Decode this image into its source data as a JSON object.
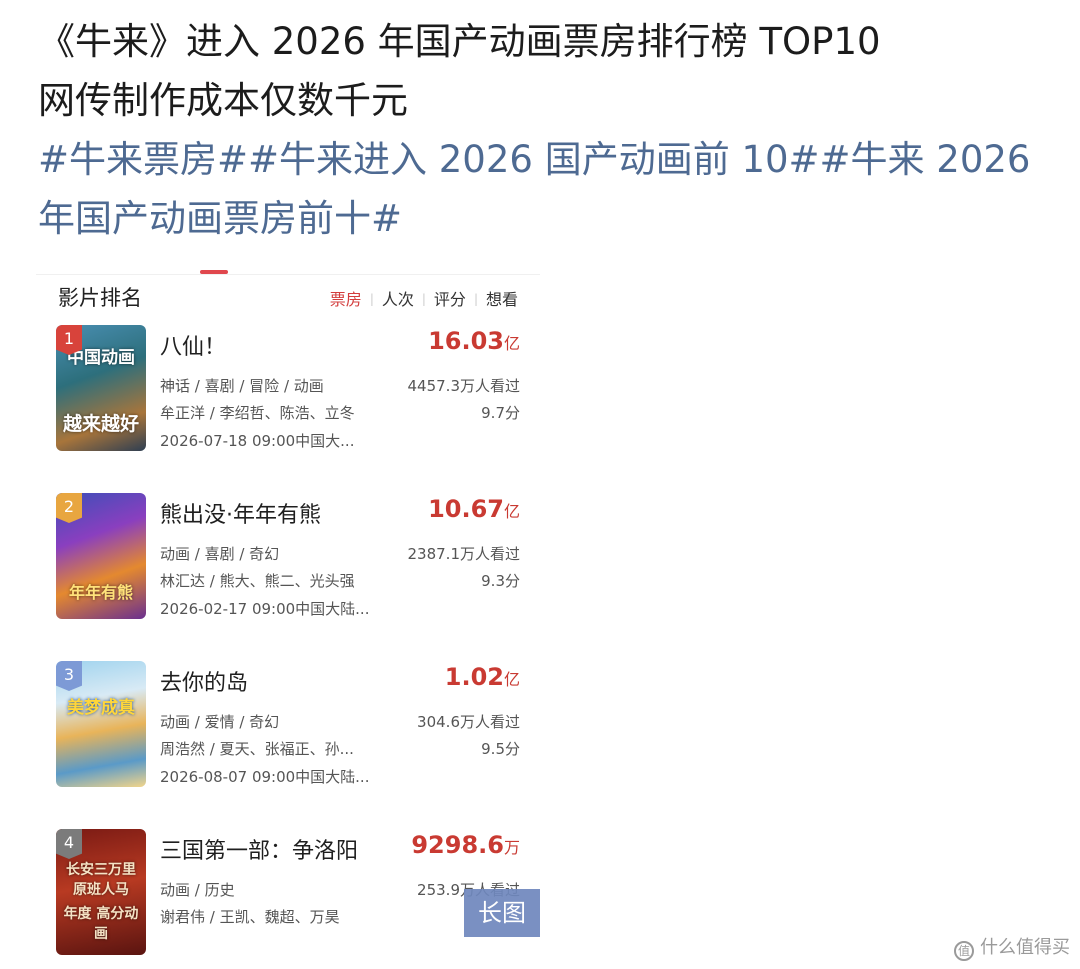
{
  "post": {
    "line1": "《牛来》进入 2026 年国产动画票房排行榜 TOP10",
    "line2": "网传制作成本仅数千元",
    "tags_line1": "#牛来票房##牛来进入 2026 国产动画前 10##牛来 2026",
    "tags_line2": "年国产动画票房前十#"
  },
  "ranking": {
    "title": "影片排名",
    "tabs": [
      "票房",
      "人次",
      "评分",
      "想看"
    ],
    "active_tab": "票房",
    "movies": [
      {
        "rank": "1",
        "name": "八仙！",
        "box_office": "16.03",
        "unit": "亿",
        "genres": "神话 / 喜剧 / 冒险 / 动画",
        "viewers": "4457.3万人看过",
        "cast": "牟正洋 / 李绍哲、陈浩、立冬",
        "score": "9.7分",
        "release": "2026-07-18 09:00中国大...",
        "poster_top": "中国动画",
        "poster_bottom": "越来越好"
      },
      {
        "rank": "2",
        "name": "熊出没·年年有熊",
        "box_office": "10.67",
        "unit": "亿",
        "genres": "动画 / 喜剧 / 奇幻",
        "viewers": "2387.1万人看过",
        "cast": "林汇达 / 熊大、熊二、光头强",
        "score": "9.3分",
        "release": "2026-02-17 09:00中国大陆...",
        "poster_top": "",
        "poster_bottom": "年年有熊"
      },
      {
        "rank": "3",
        "name": "去你的岛",
        "box_office": "1.02",
        "unit": "亿",
        "genres": "动画 / 爱情 / 奇幻",
        "viewers": "304.6万人看过",
        "cast": "周浩然 / 夏天、张福正、孙...",
        "score": "9.5分",
        "release": "2026-08-07 09:00中国大陆...",
        "poster_top": "美梦成真",
        "poster_bottom": ""
      },
      {
        "rank": "4",
        "name": "三国第一部：争洛阳",
        "box_office": "9298.6",
        "unit": "万",
        "genres": "动画 / 历史",
        "viewers": "253.9万人看过",
        "cast": "谢君伟 / 王凯、魏超、万昊",
        "score": "",
        "release": "",
        "poster_top": "长安三万里 原班人马",
        "poster_bottom": "年度 高分动画"
      }
    ]
  },
  "overlay": {
    "long_pic": "长图"
  },
  "watermark": {
    "logo": "值",
    "text": "什么值得买"
  },
  "colors": {
    "tag": "#4e6a92",
    "box_office": "#c93a32",
    "active_tab": "#d33d3d",
    "badge_1": "#d8433b",
    "badge_2": "#e8a640",
    "badge_3": "#7d9ad6",
    "badge_4": "#7b7b7b"
  }
}
